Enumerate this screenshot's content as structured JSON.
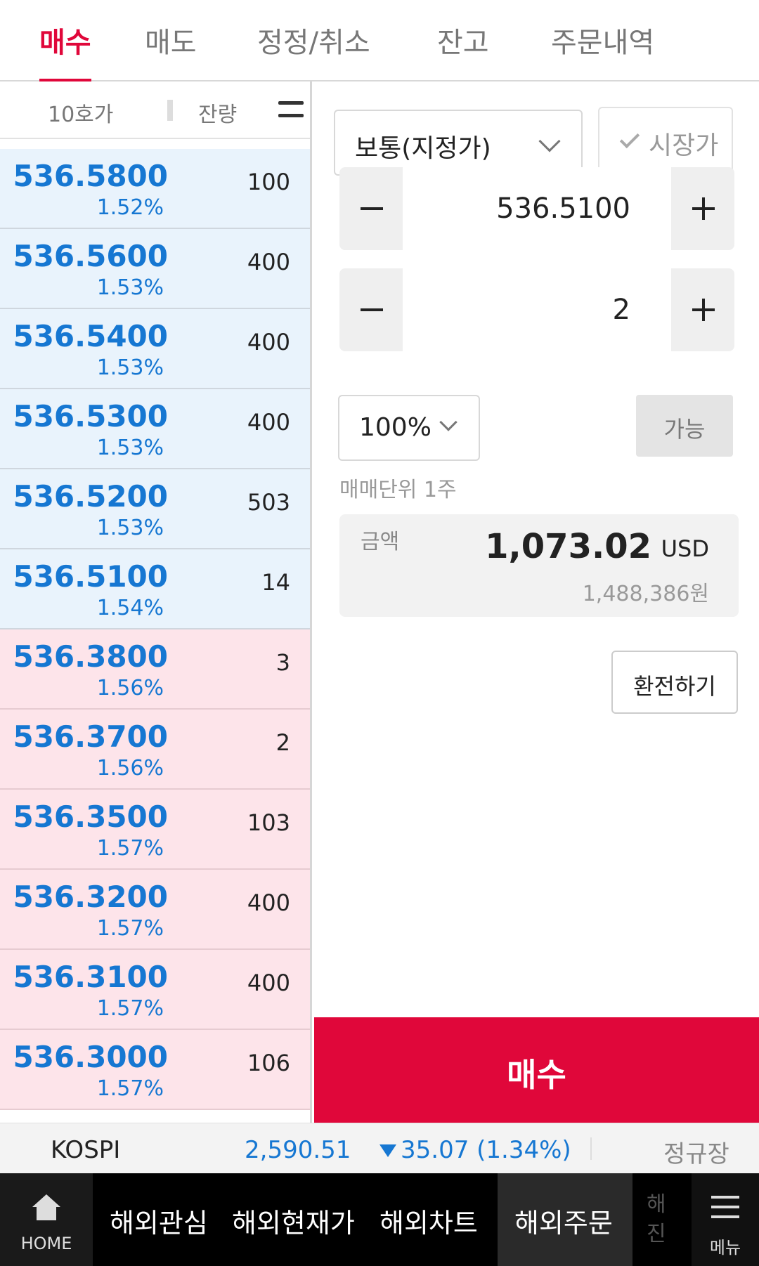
{
  "tabs": [
    "매수",
    "매도",
    "정정/취소",
    "잔고",
    "주문내역"
  ],
  "orderbook": {
    "header_left": "10호가",
    "header_right": "잔량",
    "rows": [
      {
        "price": "536.5800",
        "pct": "1.52%",
        "qty": "100",
        "side": "ask"
      },
      {
        "price": "536.5600",
        "pct": "1.53%",
        "qty": "400",
        "side": "ask"
      },
      {
        "price": "536.5400",
        "pct": "1.53%",
        "qty": "400",
        "side": "ask"
      },
      {
        "price": "536.5300",
        "pct": "1.53%",
        "qty": "400",
        "side": "ask"
      },
      {
        "price": "536.5200",
        "pct": "1.53%",
        "qty": "503",
        "side": "ask"
      },
      {
        "price": "536.5100",
        "pct": "1.54%",
        "qty": "14",
        "side": "ask"
      },
      {
        "price": "536.3800",
        "pct": "1.56%",
        "qty": "3",
        "side": "bid"
      },
      {
        "price": "536.3700",
        "pct": "1.56%",
        "qty": "2",
        "side": "bid"
      },
      {
        "price": "536.3500",
        "pct": "1.57%",
        "qty": "103",
        "side": "bid"
      },
      {
        "price": "536.3200",
        "pct": "1.57%",
        "qty": "400",
        "side": "bid"
      },
      {
        "price": "536.3100",
        "pct": "1.57%",
        "qty": "400",
        "side": "bid"
      },
      {
        "price": "536.3000",
        "pct": "1.57%",
        "qty": "106",
        "side": "bid"
      }
    ]
  },
  "order": {
    "type_label": "보통(지정가)",
    "market_label": "시장가",
    "price_value": "536.5100",
    "qty_value": "2",
    "pct_label": "100%",
    "avail_label": "가능",
    "unit_note": "매매단위 1주",
    "amount_label": "금액",
    "amount_value": "1,073.02",
    "currency": "USD",
    "amount_krw": "1,488,386원",
    "fx_label": "환전하기",
    "buy_label": "매수"
  },
  "index": {
    "name": "KOSPI",
    "value": "2,590.51",
    "change": "35.07 (1.34%)",
    "session": "정규장"
  },
  "nav": {
    "home": "HOME",
    "items": [
      "해외관심",
      "해외현재가",
      "해외차트",
      "해외주문"
    ],
    "faded": "해진",
    "menu": "메뉴"
  },
  "colors": {
    "accent": "#e0073a",
    "price_blue": "#1677d2",
    "ask_bg": "#e9f3fc",
    "bid_bg": "#fde4ea"
  }
}
